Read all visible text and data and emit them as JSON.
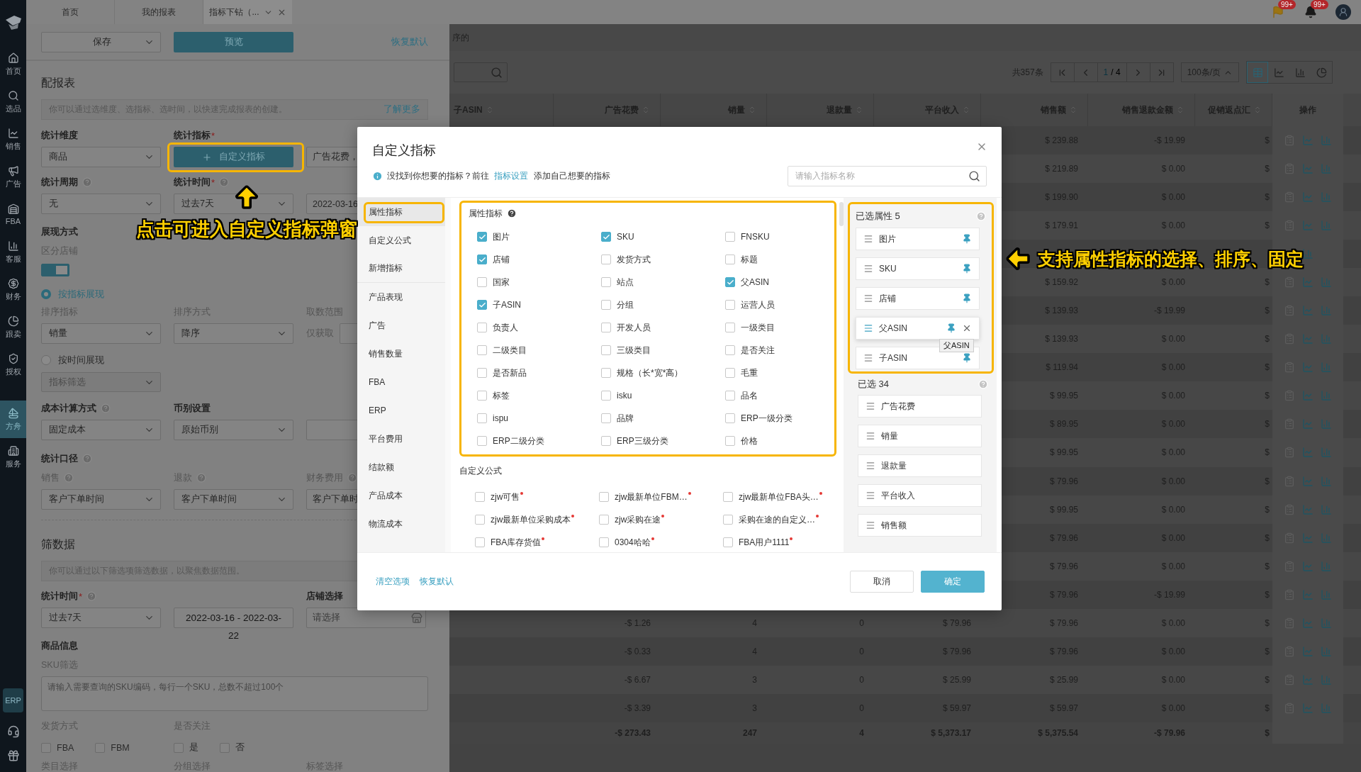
{
  "sidebar": {
    "items": [
      {
        "label": "首页",
        "selected": false
      },
      {
        "label": "选品",
        "selected": false
      },
      {
        "label": "销售",
        "selected": false
      },
      {
        "label": "广告",
        "selected": false
      },
      {
        "label": "FBA",
        "selected": false
      },
      {
        "label": "客服",
        "selected": false
      },
      {
        "label": "财务",
        "selected": false
      },
      {
        "label": "跟卖",
        "selected": false
      },
      {
        "label": "授权",
        "selected": false
      },
      {
        "label": "方舟",
        "selected": true
      },
      {
        "label": "服务",
        "selected": false
      }
    ],
    "badge": "ERP"
  },
  "tabs": [
    {
      "label": "首页",
      "selected": false,
      "closable": false
    },
    {
      "label": "我的报表",
      "selected": false,
      "closable": false
    },
    {
      "label": "指标下钻（...",
      "selected": true,
      "closable": true
    }
  ],
  "header": {
    "flag_count": "99+",
    "bell_count": "99+"
  },
  "config": {
    "save": "保存",
    "preview": "预览",
    "reset": "恢复默认",
    "title": "配报表",
    "intro": {
      "text": "你可以通过选维度、选指标、选时间，以快速完成报表的创建。",
      "link": "了解更多"
    },
    "dimension": {
      "label": "统计维度",
      "value": "商品"
    },
    "metric": {
      "label": "统计指标",
      "mark": "*",
      "button": "自定义指标",
      "summary": "广告花费，"
    },
    "period": {
      "label": "统计周期",
      "value": "无"
    },
    "time": {
      "label": "统计时间",
      "mark": "*",
      "value": "过去7天",
      "range": "2022-03-16"
    },
    "display": {
      "label": "展现方式",
      "split_label": "区分店铺",
      "split_on": true,
      "modes": [
        {
          "label": "按指标展现",
          "selected": true
        },
        {
          "label": "按时间展现",
          "selected": false
        }
      ],
      "sort_metric": {
        "label": "排序指标",
        "value": "销量"
      },
      "sort_order": {
        "label": "排序方式",
        "value": "降序"
      },
      "range": {
        "label": "取数范围",
        "prefix": "仅获取"
      },
      "filter": {
        "placeholder": "指标筛选",
        "disabled": true
      }
    },
    "cost": {
      "label": "成本计算方式",
      "value": "固定成本"
    },
    "currency": {
      "label": "币别设置",
      "value": "原始币别"
    },
    "basis": {
      "label": "统计口径",
      "fields": [
        {
          "label": "销售",
          "value": "客户下单时间"
        },
        {
          "label": "退款",
          "value": "客户下单时间"
        },
        {
          "label": "财务费用",
          "value": "客户下单时"
        }
      ]
    },
    "filter_title": "筛数据",
    "filter_intro": "你可以通过以下筛选项筛选数据，以聚焦数据范围。",
    "filter_time": {
      "label": "统计时间",
      "mark": "*",
      "value": "过去7天",
      "range_lines": [
        "2022-03-16 -  2022-03-",
        "22"
      ]
    },
    "store": {
      "label": "店铺选择",
      "placeholder": "请选择"
    },
    "product_title": "商品信息",
    "sku": {
      "label": "SKU筛选",
      "placeholder": "请输入需要查询的SKU编码，每行一个SKU，总数不超过100个"
    },
    "shipping": {
      "label": "发货方式",
      "options": [
        {
          "label": "FBA",
          "checked": false
        },
        {
          "label": "FBM",
          "checked": false
        }
      ]
    },
    "follow": {
      "label": "是否关注",
      "options": [
        {
          "label": "是",
          "checked": false
        },
        {
          "label": "否",
          "checked": false
        }
      ]
    },
    "more_labels": [
      "类目选择",
      "分组选择",
      "标签选择"
    ]
  },
  "report": {
    "note": "序的",
    "total_count": "共357条",
    "page": "1",
    "pages": "/ 4",
    "page_size": "100条/页",
    "views": [
      {
        "selected": true
      },
      {
        "selected": false
      },
      {
        "selected": false
      },
      {
        "selected": false
      }
    ],
    "columns": [
      "子ASIN",
      "广告花费",
      "销量",
      "退款量",
      "平台收入",
      "销售额",
      "销售退款金额",
      "促销返点汇",
      "操作"
    ],
    "rows": [
      [
        null,
        null,
        null,
        null,
        null,
        "$ 239.88",
        "-$ 19.99",
        "$"
      ],
      [
        null,
        null,
        null,
        null,
        null,
        "$ 219.89",
        "$ 0.00",
        "$"
      ],
      [
        null,
        null,
        null,
        null,
        null,
        "$ 199.90",
        "$ 0.00",
        "$"
      ],
      [
        null,
        null,
        null,
        null,
        null,
        "$ 179.91",
        "$ 0.00",
        "$"
      ],
      [
        null,
        null,
        null,
        null,
        null,
        null,
        null,
        null
      ],
      [
        null,
        null,
        null,
        null,
        null,
        "$ 159.92",
        "$ 0.00",
        "$"
      ],
      [
        null,
        null,
        null,
        null,
        null,
        "$ 139.93",
        "-$ 19.99",
        "$"
      ],
      [
        null,
        null,
        null,
        null,
        null,
        "$ 139.93",
        "$ 0.00",
        "$"
      ],
      [
        null,
        null,
        null,
        null,
        null,
        "$ 119.94",
        "$ 0.00",
        "$"
      ],
      [
        null,
        null,
        null,
        null,
        null,
        "$ 99.95",
        "$ 0.00",
        "$"
      ],
      [
        null,
        null,
        null,
        null,
        null,
        "$ 89.95",
        "$ 0.00",
        "$"
      ],
      [
        null,
        null,
        null,
        null,
        null,
        "$ 99.95",
        "$ 0.00",
        "$"
      ],
      [
        null,
        null,
        null,
        null,
        null,
        "$ 79.96",
        "$ 0.00",
        "$"
      ],
      [
        null,
        null,
        null,
        null,
        null,
        "$ 99.95",
        "$ 0.00",
        "$"
      ],
      [
        null,
        null,
        null,
        null,
        null,
        "$ 79.96",
        "$ 0.00",
        "$"
      ],
      [
        null,
        null,
        null,
        null,
        null,
        "$ 79.96",
        "$ 0.00",
        "$"
      ],
      [
        null,
        null,
        null,
        null,
        null,
        "$ 79.96",
        "-$ 19.99",
        "$"
      ],
      [
        null,
        "-$ 1.26",
        "4",
        "0",
        "$ 79.96",
        "$ 79.96",
        "$ 0.00",
        "$"
      ],
      [
        null,
        "-$ 0.33",
        "4",
        "0",
        "$ 79.96",
        "$ 79.96",
        "$ 0.00",
        "$"
      ],
      [
        null,
        "-$ 6.67",
        "3",
        "0",
        "$ 25.99",
        "$ 25.99",
        "$ 0.00",
        "$"
      ],
      [
        null,
        "-$ 3.39",
        "3",
        "0",
        "$ 59.97",
        "$ 59.97",
        "$ 0.00",
        "$"
      ]
    ],
    "total": [
      "-$ 273.43",
      "247",
      "4",
      "$ 5,373.17",
      "$ 5,375.54",
      "-$ 79.96",
      "$"
    ]
  },
  "modal": {
    "title": "自定义指标",
    "hint": {
      "before": "没找到你想要的指标？前往 ",
      "link": "指标设置",
      "after": " 添加自己想要的指标"
    },
    "search_placeholder": "请输入指标名称",
    "nav": [
      {
        "label": "属性指标",
        "selected": true
      },
      {
        "label": "自定义公式",
        "selected": false
      },
      {
        "label": "新增指标",
        "selected": false
      },
      {
        "label": "产品表现",
        "selected": false
      },
      {
        "label": "广告",
        "selected": false
      },
      {
        "label": "销售数量",
        "selected": false
      },
      {
        "label": "FBA",
        "selected": false
      },
      {
        "label": "ERP",
        "selected": false
      },
      {
        "label": "平台费用",
        "selected": false
      },
      {
        "label": "结款额",
        "selected": false
      },
      {
        "label": "产品成本",
        "selected": false
      },
      {
        "label": "物流成本",
        "selected": false
      }
    ],
    "attributes": {
      "title": "属性指标",
      "items": [
        {
          "label": "图片",
          "checked": true
        },
        {
          "label": "SKU",
          "checked": true
        },
        {
          "label": "FNSKU",
          "checked": false
        },
        {
          "label": "店铺",
          "checked": true
        },
        {
          "label": "发货方式",
          "checked": false
        },
        {
          "label": "标题",
          "checked": false
        },
        {
          "label": "国家",
          "checked": false
        },
        {
          "label": "站点",
          "checked": false
        },
        {
          "label": "父ASIN",
          "checked": true
        },
        {
          "label": "子ASIN",
          "checked": true
        },
        {
          "label": "分组",
          "checked": false
        },
        {
          "label": "运营人员",
          "checked": false
        },
        {
          "label": "负责人",
          "checked": false
        },
        {
          "label": "开发人员",
          "checked": false
        },
        {
          "label": "一级类目",
          "checked": false
        },
        {
          "label": "二级类目",
          "checked": false
        },
        {
          "label": "三级类目",
          "checked": false
        },
        {
          "label": "是否关注",
          "checked": false
        },
        {
          "label": "是否新品",
          "checked": false
        },
        {
          "label": "规格（长*宽*高）",
          "checked": false
        },
        {
          "label": "毛重",
          "checked": false
        },
        {
          "label": "标签",
          "checked": false
        },
        {
          "label": "isku",
          "checked": false
        },
        {
          "label": "品名",
          "checked": false
        },
        {
          "label": "ispu",
          "checked": false
        },
        {
          "label": "品牌",
          "checked": false
        },
        {
          "label": "ERP一级分类",
          "checked": false
        },
        {
          "label": "ERP二级分类",
          "checked": false
        },
        {
          "label": "ERP三级分类",
          "checked": false
        },
        {
          "label": "价格",
          "checked": false
        }
      ]
    },
    "formulas": {
      "title": "自定义公式",
      "items": [
        {
          "label": "zjw可售",
          "checked": false,
          "flagged": true
        },
        {
          "label": "zjw最新单位FBM…",
          "checked": false,
          "flagged": true
        },
        {
          "label": "zjw最新单位FBA头…",
          "checked": false,
          "flagged": true
        },
        {
          "label": "zjw最新单位采购成本",
          "checked": false,
          "flagged": true
        },
        {
          "label": "zjw采购在途",
          "checked": false,
          "flagged": true
        },
        {
          "label": "采购在途的自定义…",
          "checked": false,
          "flagged": true
        },
        {
          "label": "FBA库存货值",
          "checked": false,
          "flagged": true
        },
        {
          "label": "0304哈哈",
          "checked": false,
          "flagged": true
        },
        {
          "label": "FBA用户1111",
          "checked": false,
          "flagged": true
        }
      ]
    },
    "pinned": {
      "title": "已选属性 5",
      "items": [
        {
          "label": "图片",
          "hovered": false
        },
        {
          "label": "SKU",
          "hovered": false
        },
        {
          "label": "店铺",
          "hovered": false
        },
        {
          "label": "父ASIN",
          "hovered": true
        },
        {
          "label": "子ASIN",
          "hovered": false
        }
      ],
      "tooltip": "父ASIN"
    },
    "chosen": {
      "title": "已选 34",
      "items": [
        "广告花费",
        "销量",
        "退款量",
        "平台收入",
        "销售额"
      ]
    },
    "footer": {
      "clear": "清空选项",
      "reset": "恢复默认",
      "cancel": "取消",
      "ok": "确定"
    }
  },
  "annotations": [
    {
      "text": "点击可进入自定义指标弹窗",
      "kind": "up"
    },
    {
      "text": "支持属性指标的选择、排序、固定",
      "kind": "left"
    }
  ]
}
